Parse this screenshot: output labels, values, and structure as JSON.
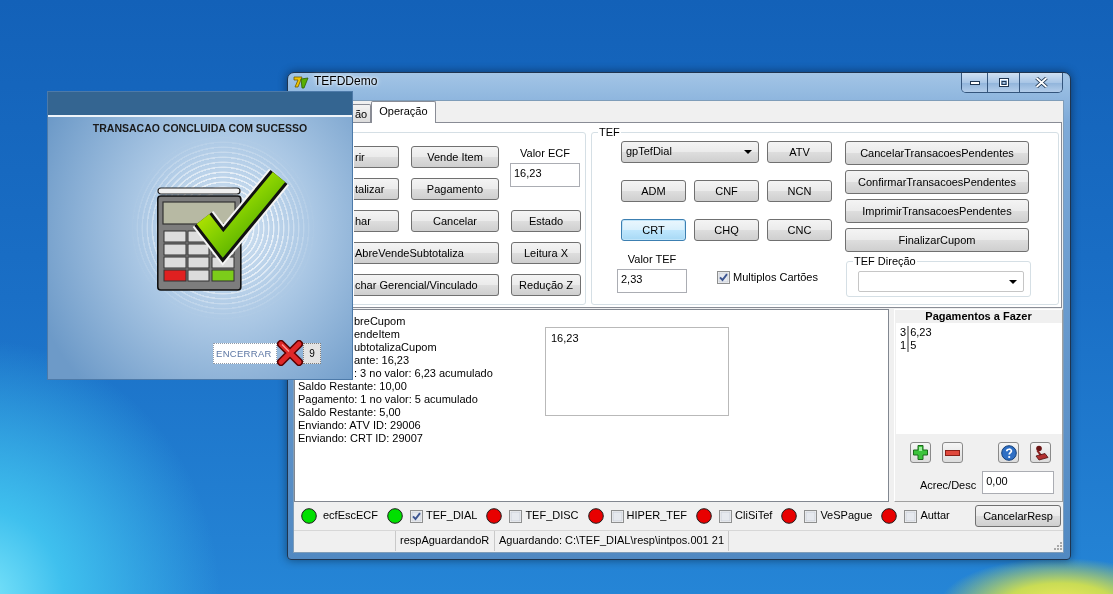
{
  "dialog": {
    "message": "TRANSACAO CONCLUIDA COM SUCESSO",
    "close_label": "ENCERRAR",
    "countdown": "9"
  },
  "window": {
    "title": "TEFDDemo"
  },
  "tabs": [
    {
      "label": "ão",
      "selected": false
    },
    {
      "label": "Operação",
      "selected": true
    }
  ],
  "ecf": {
    "buttons": [
      {
        "label": "rir",
        "wide": false
      },
      {
        "label": "Vende Item",
        "wide": false
      },
      {
        "label": "talizar",
        "wide": false
      },
      {
        "label": "Pagamento",
        "wide": false
      },
      {
        "label": "har",
        "wide": false
      },
      {
        "label": "Cancelar",
        "wide": false
      },
      {
        "label": "Estado",
        "wide": false
      },
      {
        "label": "AbreVendeSubtotaliza",
        "wide": true
      },
      {
        "label": "Leitura X",
        "wide": false
      },
      {
        "label": "char Gerencial/Vinculado",
        "wide": true
      },
      {
        "label": "Redução Z",
        "wide": false
      }
    ],
    "valor": {
      "label": "Valor ECF",
      "value": "16,23"
    }
  },
  "tef": {
    "title": "TEF",
    "gateway": "gpTefDial",
    "buttons": [
      {
        "label": "ATV",
        "focused": false
      },
      {
        "label": "ADM",
        "focused": false
      },
      {
        "label": "CNF",
        "focused": false
      },
      {
        "label": "NCN",
        "focused": false
      },
      {
        "label": "CRT",
        "focused": true
      },
      {
        "label": "CHQ",
        "focused": false
      },
      {
        "label": "CNC",
        "focused": false
      }
    ],
    "pending_buttons": [
      "CancelarTransacoesPendentes",
      "ConfirmarTransacoesPendentes",
      "ImprimirTransacoesPendentes",
      "FinalizarCupom"
    ],
    "valor": {
      "label": "Valor TEF",
      "value": "2,33"
    },
    "multiple_cards": {
      "label": "Multiplos Cartões",
      "checked": true
    },
    "direction": {
      "title": "TEF Direção"
    }
  },
  "log": {
    "lines": [
      "breCupom",
      "endeItem",
      "ubtotalizaCupom",
      "ante: 16,23",
      ": 3 no valor: 6,23 acumulado",
      "Saldo Restante: 10,00",
      "Pagamento: 1 no valor: 5 acumulado",
      "Saldo Restante: 5,00",
      "Enviando: ATV ID: 29006",
      "Enviando: CRT ID: 29007"
    ],
    "memo": "16,23"
  },
  "payments": {
    "title": "Pagamentos a Fazer",
    "rows": [
      {
        "payment": "3",
        "amount": "6,23"
      },
      {
        "payment": "1",
        "amount": "5"
      }
    ],
    "adjustment": {
      "label": "Acrec/Desc",
      "value": "0,00"
    }
  },
  "connections": [
    {
      "kind": "light",
      "label": "ecfEscECF",
      "color": "#00e000"
    },
    {
      "kind": "toggle",
      "label": "TEF_DIAL",
      "color": "#00e000",
      "checked": true
    },
    {
      "kind": "toggle",
      "label": "TEF_DISC",
      "color": "#e80000",
      "checked": false
    },
    {
      "kind": "toggle",
      "label": "HIPER_TEF",
      "color": "#e80000",
      "checked": false
    },
    {
      "kind": "toggle",
      "label": "CliSiTef",
      "color": "#e80000",
      "checked": false
    },
    {
      "kind": "toggle",
      "label": "VeSPague",
      "color": "#e80000",
      "checked": false
    },
    {
      "kind": "toggle",
      "label": "Auttar",
      "color": "#e80000",
      "checked": false
    }
  ],
  "cancel_button": "CancelarResp",
  "status_bar": {
    "panels": [
      "respAguardandoR",
      "Aguardando: C:\\TEF_DIAL\\resp\\intpos.001 21"
    ]
  }
}
